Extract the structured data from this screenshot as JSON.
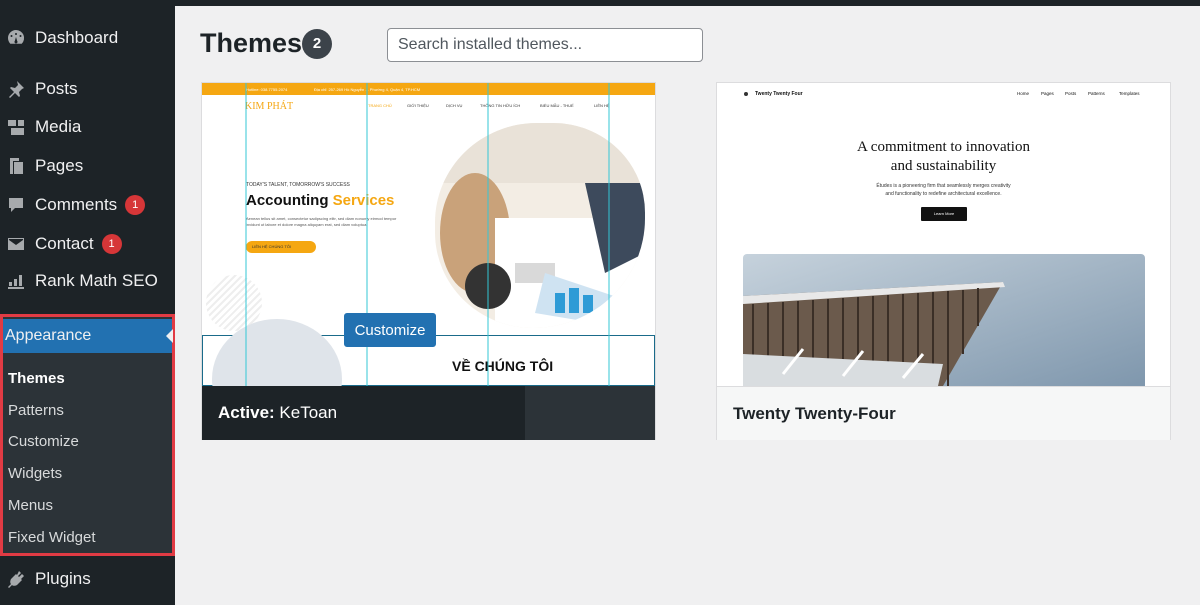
{
  "sidebar": {
    "items": [
      {
        "label": "Dashboard",
        "icon": "dashboard-icon"
      },
      {
        "label": "Posts",
        "icon": "pin-icon"
      },
      {
        "label": "Media",
        "icon": "media-icon"
      },
      {
        "label": "Pages",
        "icon": "pages-icon"
      },
      {
        "label": "Comments",
        "icon": "comment-icon",
        "badge": "1"
      },
      {
        "label": "Contact",
        "icon": "mail-icon",
        "badge": "1"
      },
      {
        "label": "Rank Math SEO",
        "icon": "chart-icon"
      },
      {
        "label": "Appearance",
        "icon": "brush-icon"
      },
      {
        "label": "Plugins",
        "icon": "plug-icon"
      }
    ],
    "submenu": [
      "Themes",
      "Patterns",
      "Customize",
      "Widgets",
      "Menus",
      "Fixed Widget"
    ]
  },
  "main": {
    "title": "Themes",
    "count": "2",
    "search_placeholder": "Search installed themes..."
  },
  "themes": [
    {
      "name": "KeToan",
      "active_label": "Active:",
      "customize_label": "Customize",
      "preview": {
        "topbar_left": "Hotline: 038.7755.2074",
        "topbar_address": "Địa chỉ: 257-269 Hồ Nguyễn ... Phường 4, Quận 4, TP.HCM",
        "logo": "KIM PHÁT",
        "nav": [
          "TRANG CHỦ",
          "GIỚI THIỆU",
          "DỊCH VỤ",
          "THÔNG TIN HỮU ÍCH",
          "BIỂU MẪU - THUẾ",
          "LIÊN HỆ"
        ],
        "tagline": "TODAY'S TALENT, TOMORROW'S SUCCESS",
        "headline_part1": "Accounting",
        "headline_part2": "Services",
        "body": "Aenean tellus sit amet, consectetur sadipscing elitr, sed diam nonumy eirmod tempor invidunt ut labore et dolore magna aliquyam erat, sed diam voluptua.",
        "cta": "LIÊN HỆ CHÚNG TÔI",
        "section_title": "VỀ CHÚNG TÔI"
      }
    },
    {
      "name": "Twenty Twenty-Four",
      "preview": {
        "brand": "Twenty Twenty Four",
        "nav": [
          "Home",
          "Pages",
          "Posts",
          "Patterns",
          "Templates"
        ],
        "heading_line1": "A commitment to innovation",
        "heading_line2": "and sustainability",
        "sub_line1": "Études is a pioneering firm that seamlessly merges creativity",
        "sub_line2": "and functionality to redefine architectural excellence.",
        "button": "Learn More"
      }
    }
  ],
  "colors": {
    "sidebar_bg": "#1d2327",
    "accent": "#2271b1",
    "highlight_border": "#e13b44",
    "badge": "#d63638",
    "ketoan_orange": "#f5a712"
  }
}
